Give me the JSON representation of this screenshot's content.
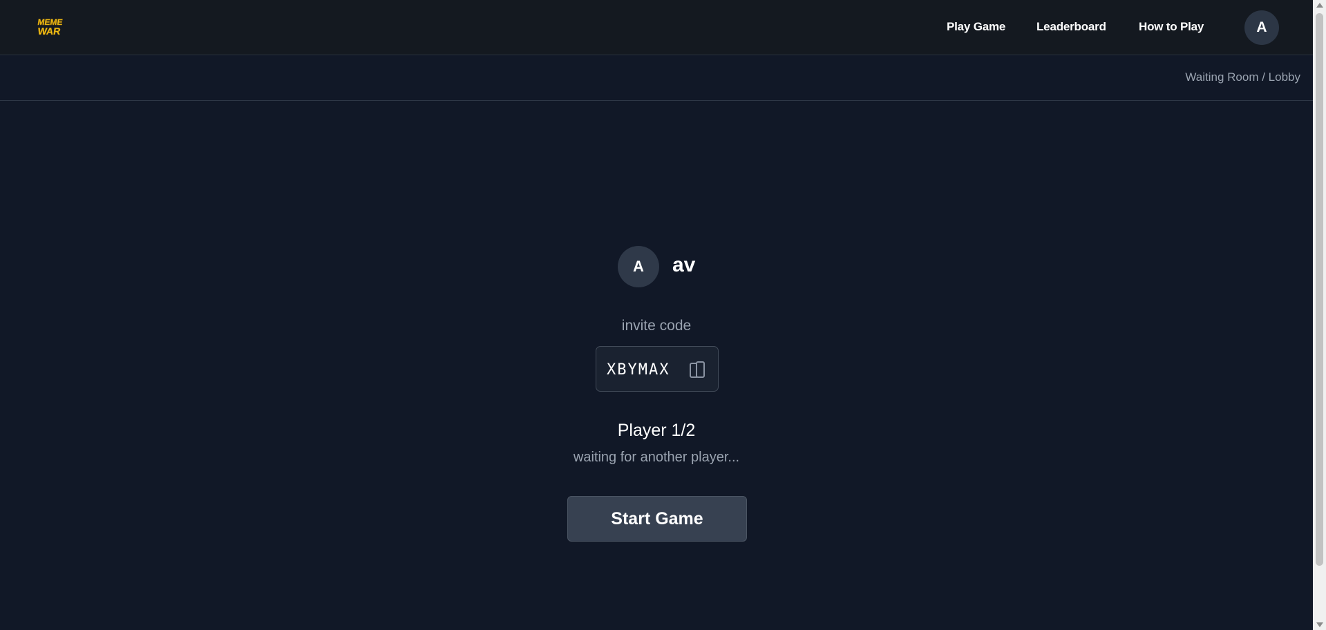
{
  "header": {
    "logo_text": "MEME WAR",
    "nav": {
      "play_game": "Play Game",
      "leaderboard": "Leaderboard",
      "how_to_play": "How to Play"
    },
    "user_avatar_initial": "A"
  },
  "breadcrumb": "Waiting Room / Lobby",
  "lobby": {
    "host_initial": "A",
    "host_name": "av",
    "invite_label": "invite code",
    "invite_code": "XBYMAX",
    "player_count": "Player 1/2",
    "status": "waiting for another player...",
    "start_button": "Start Game"
  },
  "colors": {
    "background": "#111827",
    "header_bg": "#141920",
    "button_bg": "#374151",
    "muted_text": "#9aa3b0",
    "logo_yellow": "#f5c518"
  },
  "icons": {
    "copy": "copy-icon",
    "logo": "meme-war-logo"
  }
}
